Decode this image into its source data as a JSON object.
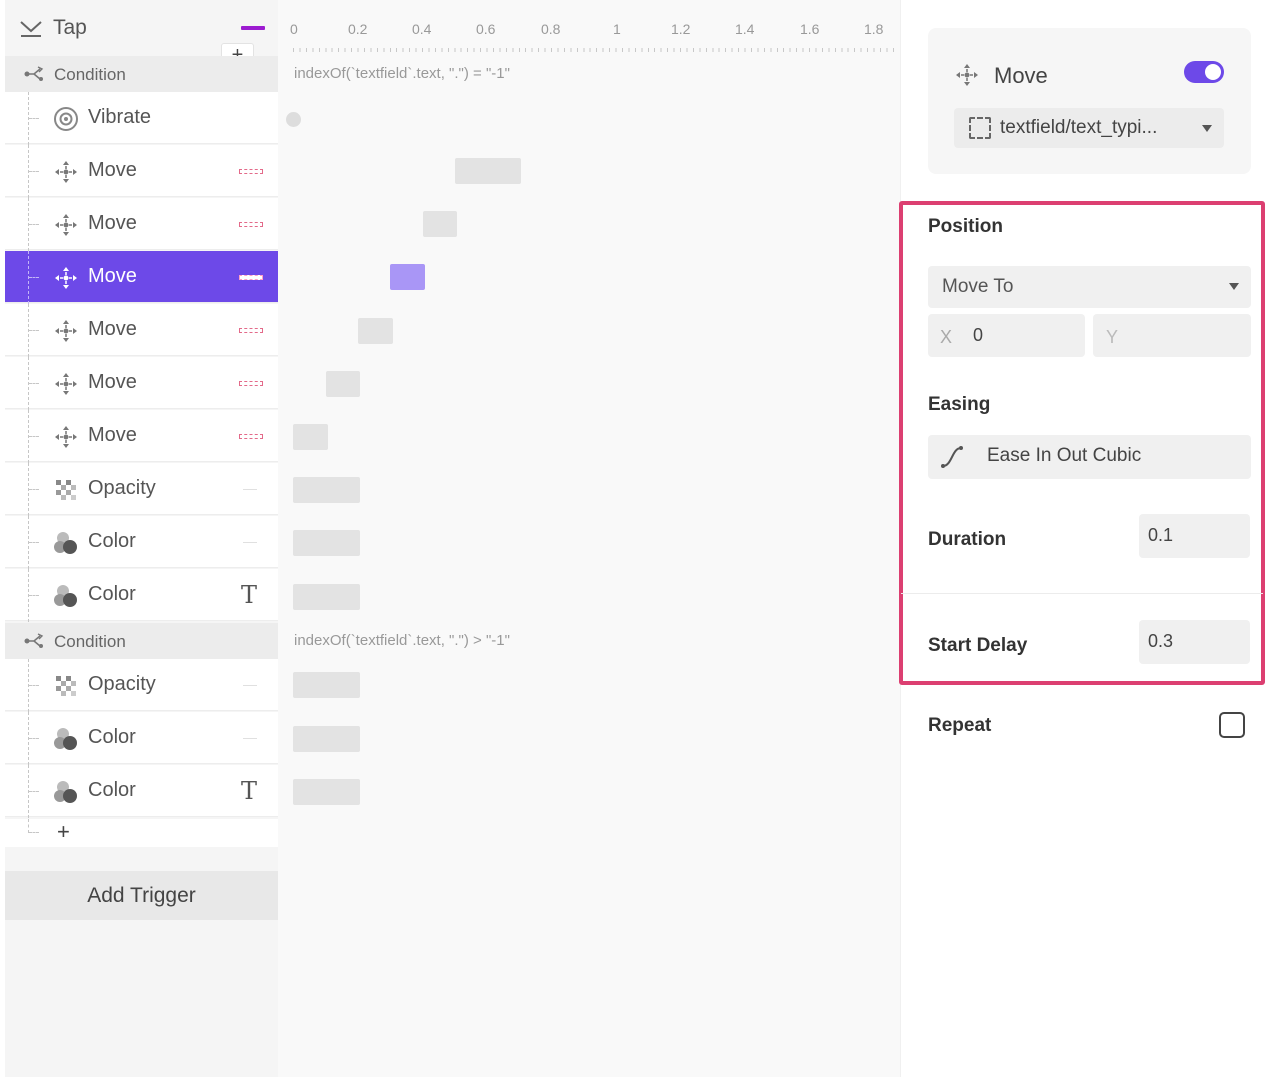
{
  "trigger": {
    "label": "Tap",
    "add_label": "+",
    "swatch_color": "#9c1bd0"
  },
  "conditions": [
    {
      "label": "Condition",
      "expression": "indexOf(`textfield`.text, \".\") = \"-1\""
    },
    {
      "label": "Condition",
      "expression": "indexOf(`textfield`.text, \".\") > \"-1\""
    }
  ],
  "actions": [
    {
      "label": "Vibrate",
      "icon": "vibrate-icon"
    },
    {
      "label": "Move",
      "icon": "move-icon"
    },
    {
      "label": "Move",
      "icon": "move-icon"
    },
    {
      "label": "Move",
      "icon": "move-icon",
      "selected": true
    },
    {
      "label": "Move",
      "icon": "move-icon"
    },
    {
      "label": "Move",
      "icon": "move-icon"
    },
    {
      "label": "Move",
      "icon": "move-icon"
    },
    {
      "label": "Opacity",
      "icon": "opacity-icon"
    },
    {
      "label": "Color",
      "icon": "color-icon"
    },
    {
      "label": "Color",
      "icon": "color-icon",
      "indicator": "T"
    },
    {
      "label": "Opacity",
      "icon": "opacity-icon"
    },
    {
      "label": "Color",
      "icon": "color-icon"
    },
    {
      "label": "Color",
      "icon": "color-icon",
      "indicator": "T"
    }
  ],
  "add_action_label": "+",
  "add_trigger_label": "Add Trigger",
  "timeline": {
    "ruler_labels": [
      "0",
      "0.2",
      "0.4",
      "0.6",
      "0.8",
      "1",
      "1.2",
      "1.4",
      "1.6",
      "1.8"
    ]
  },
  "properties": {
    "title": "Move",
    "enabled": true,
    "target": "textfield/text_typi...",
    "position_label": "Position",
    "position_mode": "Move To",
    "x_label": "X",
    "x_value": "0",
    "y_placeholder": "Y",
    "easing_label": "Easing",
    "easing_value": "Ease In Out Cubic",
    "duration_label": "Duration",
    "duration_value": "0.1",
    "start_delay_label": "Start Delay",
    "start_delay_value": "0.3",
    "repeat_label": "Repeat",
    "repeat_checked": false
  },
  "colors": {
    "accent": "#6d49e8",
    "selected_bar": "#a996f6",
    "highlight_border": "#dc3f71"
  }
}
